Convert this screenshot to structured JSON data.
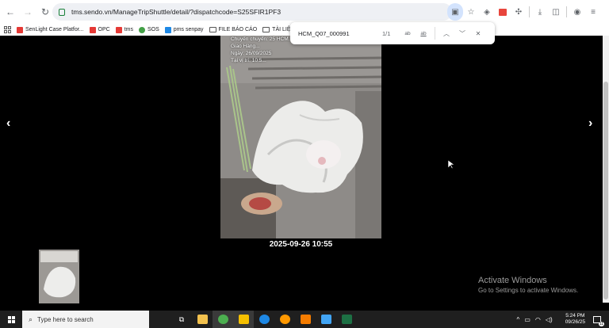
{
  "browser": {
    "url": "tms.sendo.vn/ManageTripShuttle/detail/?dispatchcode=S25SFIR1PF3",
    "bookmarks": [
      {
        "label": "SenLight Case Platfor...",
        "color": "#e53935"
      },
      {
        "label": "OPC",
        "color": "#e53935"
      },
      {
        "label": "tms",
        "color": "#e53935"
      },
      {
        "label": "SOS",
        "color": "#43a047"
      },
      {
        "label": "pms senpay",
        "color": "#1e88e5"
      },
      {
        "label": "FILE BÁO CÁO",
        "color": "folder"
      },
      {
        "label": "TÀI LIỆU",
        "color": "folder"
      }
    ]
  },
  "find_bar": {
    "query": "HCM_Q07_000991",
    "count": "1/1",
    "match_case_label": "ab",
    "whole_word_label": "ab"
  },
  "viewer": {
    "overlay_lines": [
      "Chuyến chuyển: 25 HCM...",
      "Giao Hàng...",
      "Ngày: 26/09/2025",
      "Tại vị trí: 10:5..."
    ],
    "datetime": "2025-09-26 10:55",
    "prev_icon": "‹",
    "next_icon": "›"
  },
  "watermark": {
    "title": "Activate Windows",
    "subtitle": "Go to Settings to activate Windows."
  },
  "taskbar": {
    "search_placeholder": "Type here to search",
    "time": "5:24 PM",
    "date": "09/26/25",
    "notifications": "11"
  }
}
